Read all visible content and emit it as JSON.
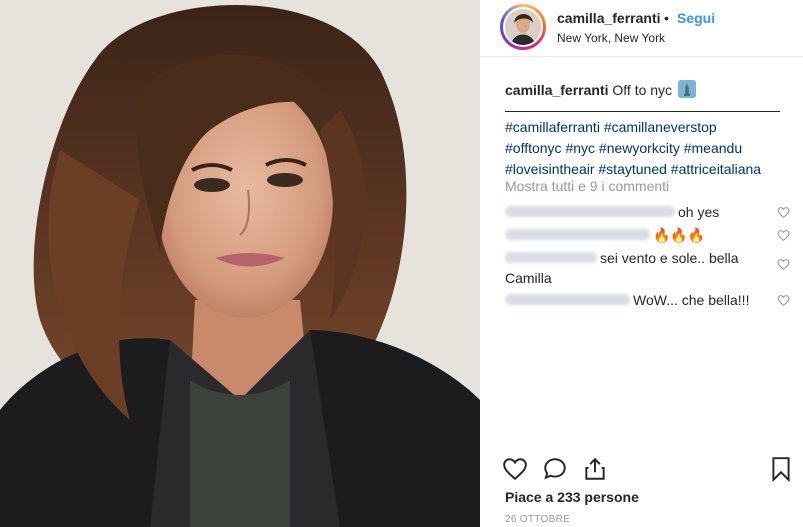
{
  "post": {
    "username": "camilla_ferranti",
    "separator": "•",
    "follow_label": "Segui",
    "location": "New York, New York",
    "caption_text": "Off to nyc",
    "caption_emoji": "statue-of-liberty-emoji",
    "hashtags": [
      "#camillaferranti",
      "#camillaneverstop",
      "#offtonyc",
      "#nyc",
      "#newyorkcity",
      "#meandu",
      "#loveisintheair",
      "#staytuned",
      "#attriceitaliana"
    ],
    "view_all_comments": "Mostra tutti e 9 i commenti",
    "comments": [
      {
        "author": "",
        "text": "oh yes"
      },
      {
        "author": "",
        "text": "🔥🔥🔥"
      },
      {
        "author": "",
        "text": "sei vento e sole.. bella Camilla"
      },
      {
        "author": "",
        "text": "WoW... che bella!!!"
      }
    ],
    "likes": "Piace a 233 persone",
    "date": "26 OTTOBRE"
  },
  "icons": {
    "like": "heart-icon",
    "comment": "comment-icon",
    "share": "share-icon",
    "save": "bookmark-icon"
  },
  "colors": {
    "follow": "#3897f0",
    "hashtag": "#003569",
    "muted": "#999999"
  }
}
